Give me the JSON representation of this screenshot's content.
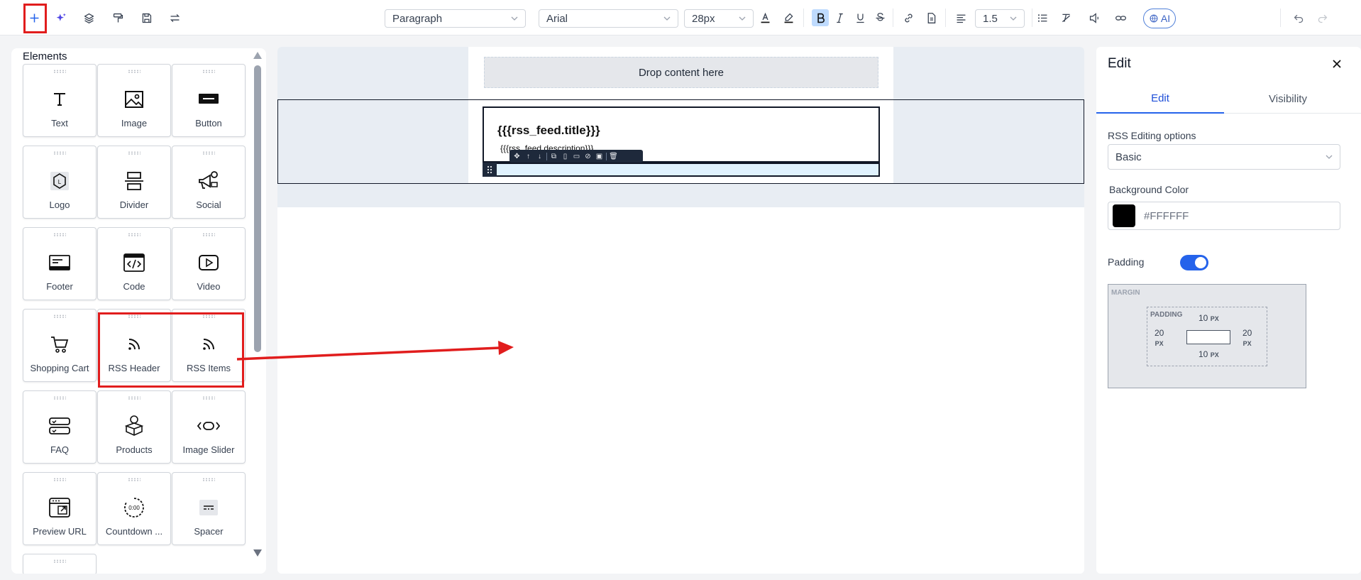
{
  "toolbar": {
    "block_type": "Paragraph",
    "font_family": "Arial",
    "font_size": "28px",
    "line_height": "1.5",
    "ai_label": "AI",
    "icons": [
      "plus-icon",
      "sparkle-icon",
      "layers-icon",
      "paint-roller-icon",
      "save-icon",
      "swap-icon",
      "text-color-icon",
      "highlight-icon",
      "bold-icon",
      "italic-icon",
      "underline-icon",
      "strikethrough-icon",
      "link-icon",
      "document-icon",
      "align-left-icon",
      "list-icon",
      "clear-format-icon",
      "speaker-icon",
      "link-chain-icon",
      "undo-icon",
      "redo-icon"
    ]
  },
  "left_panel": {
    "title": "Elements",
    "tiles": [
      {
        "label": "Text",
        "icon": "text-icon"
      },
      {
        "label": "Image",
        "icon": "image-icon"
      },
      {
        "label": "Button",
        "icon": "button-icon"
      },
      {
        "label": "Logo",
        "icon": "logo-icon"
      },
      {
        "label": "Divider",
        "icon": "divider-icon"
      },
      {
        "label": "Social",
        "icon": "social-icon"
      },
      {
        "label": "Footer",
        "icon": "footer-icon"
      },
      {
        "label": "Code",
        "icon": "code-icon"
      },
      {
        "label": "Video",
        "icon": "video-icon"
      },
      {
        "label": "Shopping Cart",
        "icon": "cart-icon"
      },
      {
        "label": "RSS Header",
        "icon": "rss-icon"
      },
      {
        "label": "RSS Items",
        "icon": "rss-icon"
      },
      {
        "label": "FAQ",
        "icon": "faq-icon"
      },
      {
        "label": "Products",
        "icon": "products-icon"
      },
      {
        "label": "Image Slider",
        "icon": "slider-icon"
      },
      {
        "label": "Preview URL",
        "icon": "preview-url-icon"
      },
      {
        "label": "Countdown ...",
        "icon": "countdown-icon"
      },
      {
        "label": "Spacer",
        "icon": "spacer-icon"
      }
    ]
  },
  "canvas": {
    "drop_text": "Drop content here",
    "rss_title": "{{{rss_feed.title}}}",
    "rss_description": "{{{rss_feed.description}}}"
  },
  "right_panel": {
    "title": "Edit",
    "tabs": [
      {
        "label": "Edit",
        "active": true
      },
      {
        "label": "Visibility",
        "active": false
      }
    ],
    "rss_options_label": "RSS Editing options",
    "rss_options_value": "Basic",
    "bg_color_label": "Background Color",
    "bg_color_value": "#FFFFFF",
    "bg_swatch_color": "#000000",
    "padding_label": "Padding",
    "padding_enabled": true,
    "margin_label": "MARGIN",
    "padding_box_label": "PADDING",
    "padding_top": "10",
    "padding_bottom": "10",
    "padding_left": "20",
    "padding_right": "20",
    "unit": "PX"
  },
  "colors": {
    "annotation_red": "#e11d1d",
    "accent_blue": "#2563eb"
  }
}
